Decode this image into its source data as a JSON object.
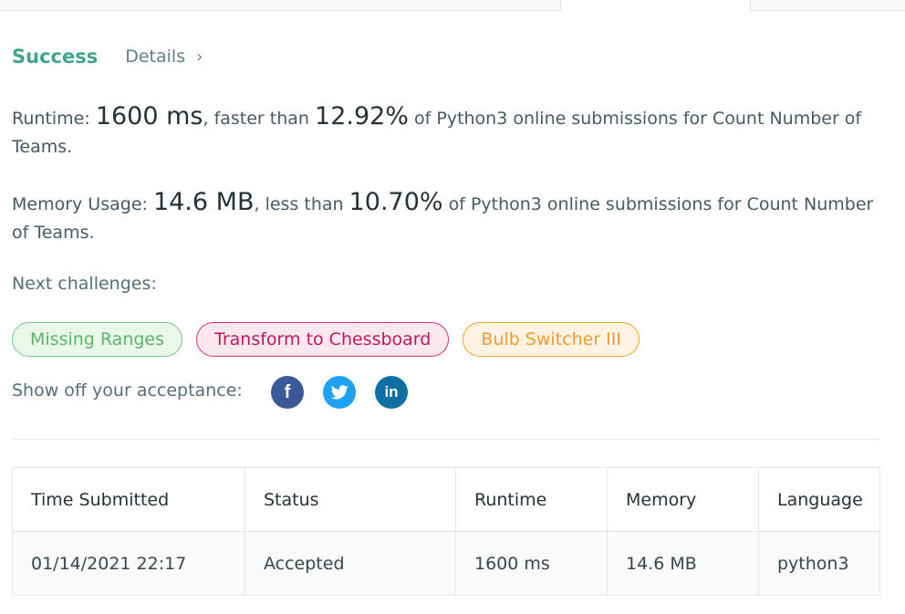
{
  "result": {
    "status": "Success",
    "details_label": "Details",
    "runtime_prefix": "Runtime: ",
    "runtime_value": "1600 ms",
    "runtime_mid": ", faster than ",
    "runtime_percent": "12.92%",
    "runtime_suffix": " of Python3 online submissions for Count Number of Teams.",
    "memory_prefix": "Memory Usage: ",
    "memory_value": "14.6 MB",
    "memory_mid": ", less than ",
    "memory_percent": "10.70%",
    "memory_suffix": " of Python3 online submissions for Count Number of Teams."
  },
  "next": {
    "label": "Next challenges:",
    "challenges": [
      "Missing Ranges",
      "Transform to Chessboard",
      "Bulb Switcher III"
    ]
  },
  "share": {
    "label": "Show off your acceptance:",
    "facebook_glyph": "f",
    "linkedin_glyph": "in"
  },
  "colors": {
    "success": "#3fa58a",
    "facebook": "#3b5998",
    "twitter": "#1da1f2",
    "linkedin": "#0e6fa3"
  },
  "icons": [
    "chevron-right-icon",
    "facebook-icon",
    "twitter-icon",
    "linkedin-icon"
  ],
  "submissions": {
    "headers": [
      "Time Submitted",
      "Status",
      "Runtime",
      "Memory",
      "Language"
    ],
    "rows": [
      [
        "01/14/2021 22:17",
        "Accepted",
        "1600 ms",
        "14.6 MB",
        "python3"
      ]
    ]
  }
}
